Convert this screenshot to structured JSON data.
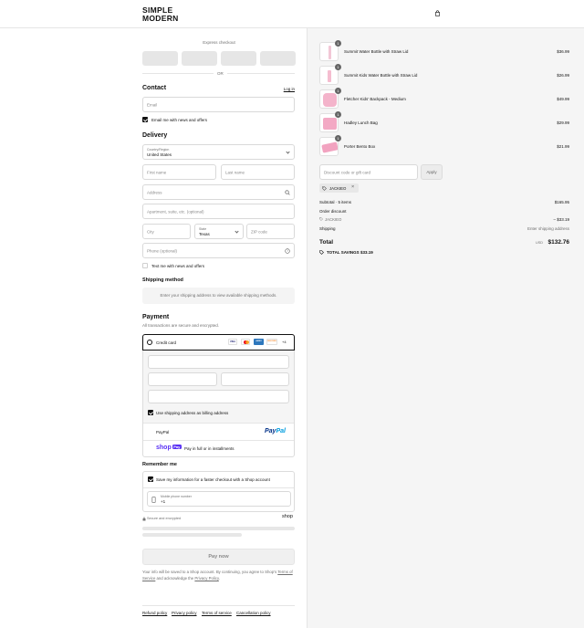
{
  "header": {
    "logo": "SIMPLE\nMODERN"
  },
  "express": {
    "title": "Express checkout",
    "or": "OR"
  },
  "contact": {
    "title": "Contact",
    "login": "Log in",
    "email_placeholder": "Email",
    "news_label": "Email me with news and offers"
  },
  "delivery": {
    "title": "Delivery",
    "country_label": "Country/Region",
    "country_value": "United States",
    "first_name": "First name",
    "last_name": "Last name",
    "address": "Address",
    "apartment": "Apartment, suite, etc. (optional)",
    "city": "City",
    "state_label": "State",
    "state_value": "Texas",
    "zip": "ZIP code",
    "phone": "Phone (optional)",
    "text_label": "Text me with news and offers"
  },
  "shipping": {
    "title": "Shipping method",
    "message": "Enter your shipping address to view available shipping methods."
  },
  "payment": {
    "title": "Payment",
    "subtitle": "All transactions are secure and encrypted.",
    "credit_card": "Credit card",
    "card_logos": [
      "VISA",
      "MC",
      "AMEX",
      "DISCOVER",
      "+4"
    ],
    "billing_label": "Use shipping address as billing address",
    "paypal": "PayPal",
    "shoppay_badge": "shop",
    "shoppay_desc": "Pay in full or in installments"
  },
  "remember": {
    "title": "Remember me",
    "save_label": "Save my information for a faster checkout with a Shop account",
    "phone_label": "Mobile phone number",
    "phone_value": "+1",
    "secure": "Secure and encrypted",
    "shop": "shop"
  },
  "pay_button": "Pay now",
  "legal": {
    "text_1": "Your info will be saved to a Shop account. By continuing, you agree to Shop's",
    "terms": "Terms of Service",
    "text_2": "and acknowledge the",
    "privacy": "Privacy Policy",
    "end": "."
  },
  "footer_links": [
    "Refund policy",
    "Privacy policy",
    "Terms of service",
    "Cancellation policy"
  ],
  "cart": {
    "items": [
      {
        "qty": "1",
        "name": "Summit Water Bottle with Straw Lid",
        "price": "$36.99"
      },
      {
        "qty": "1",
        "name": "Summit Kids Water Bottle with Straw Lid",
        "price": "$26.99"
      },
      {
        "qty": "1",
        "name": "Fletcher Kids' Backpack - Medium",
        "price": "$49.99"
      },
      {
        "qty": "1",
        "name": "Hadley Lunch Bag",
        "price": "$29.99"
      },
      {
        "qty": "1",
        "name": "Porter Bento Box",
        "price": "$21.99"
      }
    ],
    "discount_placeholder": "Discount code or gift card",
    "apply": "Apply",
    "code_tag": "JACKIEO",
    "subtotal_label": "Subtotal · 5 items",
    "subtotal_value": "$165.95",
    "order_discount": "Order discount",
    "discount_code": "JACKIEO",
    "discount_value": "– $33.19",
    "shipping_label": "Shipping",
    "shipping_value": "Enter shipping address",
    "total_label": "Total",
    "currency": "USD",
    "total_value": "$132.76",
    "savings_label": "TOTAL SAVINGS",
    "savings_value": "$33.19"
  }
}
